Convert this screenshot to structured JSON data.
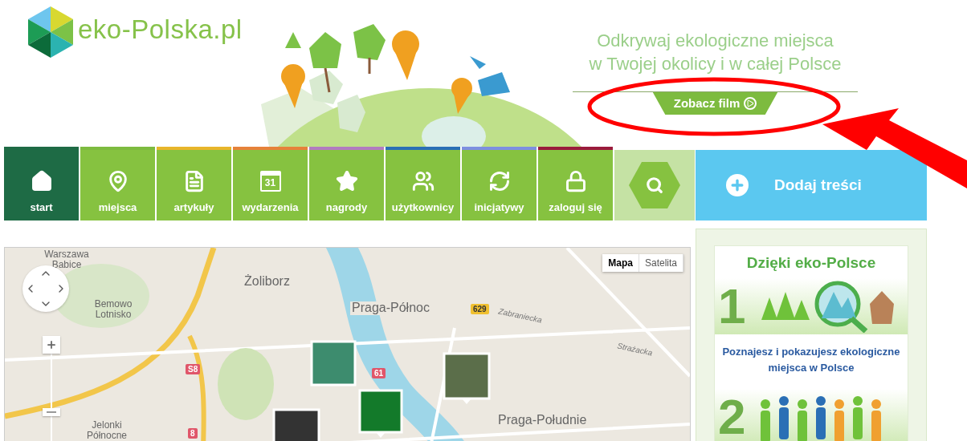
{
  "header": {
    "logo": "eko-Polska.pl",
    "tagline": [
      "Odkrywaj ekologiczne miejsca",
      "w Twojej okolicy i w całej Polsce"
    ],
    "video_button": "Zobacz film"
  },
  "nav": {
    "items": [
      {
        "label": "start",
        "kind": "home",
        "selected": true,
        "color": "#1e6b45"
      },
      {
        "label": "miejsca",
        "kind": "pin",
        "selected": false,
        "color": "#7dbb3f"
      },
      {
        "label": "artykuły",
        "kind": "document",
        "selected": false,
        "color": "#e8b52a"
      },
      {
        "label": "wydarzenia",
        "kind": "calendar",
        "badge": "31",
        "selected": false,
        "color": "#e6823a"
      },
      {
        "label": "nagrody",
        "kind": "star",
        "selected": false,
        "color": "#b27cc0"
      },
      {
        "label": "użytkownicy",
        "kind": "users",
        "selected": false,
        "color": "#2a6fb5"
      },
      {
        "label": "inicjatywy",
        "kind": "refresh",
        "selected": false,
        "color": "#7d8fe0"
      },
      {
        "label": "zaloguj się",
        "kind": "lock",
        "selected": false,
        "color": "#9a1b3c"
      }
    ],
    "add_button": "Dodaj treści"
  },
  "map": {
    "map_types": [
      {
        "label": "Mapa",
        "selected": true
      },
      {
        "label": "Satelita",
        "selected": false
      }
    ],
    "labels": [
      {
        "text": "Warszawa Babice",
        "kind": "place"
      },
      {
        "text": "Żoliborz",
        "kind": "district"
      },
      {
        "text": "Bemowo Lotnisko",
        "kind": "place"
      },
      {
        "text": "Praga-Północ",
        "kind": "district"
      },
      {
        "text": "629",
        "kind": "road"
      },
      {
        "text": "Zabraniecka",
        "kind": "street"
      },
      {
        "text": "Strażacka",
        "kind": "street"
      },
      {
        "text": "S8",
        "kind": "route"
      },
      {
        "text": "61",
        "kind": "route"
      },
      {
        "text": "Jelonki Północne",
        "kind": "place"
      },
      {
        "text": "Praga-Południe",
        "kind": "district"
      },
      {
        "text": "8",
        "kind": "route"
      }
    ]
  },
  "sidebar": {
    "title": "Dzięki eko-Polsce",
    "steps": [
      {
        "number": "1",
        "caption": "Poznajesz i pokazujesz ekologiczne miejsca w Polsce"
      },
      {
        "number": "2"
      }
    ]
  }
}
